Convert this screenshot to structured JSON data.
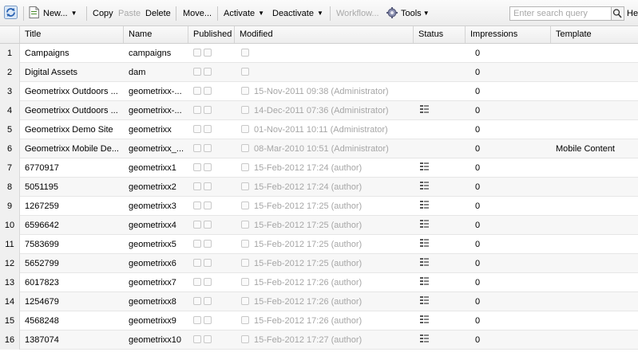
{
  "toolbar": {
    "new_label": "New...",
    "copy_label": "Copy",
    "paste_label": "Paste",
    "delete_label": "Delete",
    "move_label": "Move...",
    "activate_label": "Activate",
    "deactivate_label": "Deactivate",
    "workflow_label": "Workflow...",
    "tools_label": "Tools",
    "help_label": "He",
    "search_placeholder": "Enter search query"
  },
  "columns": {
    "title": "Title",
    "name": "Name",
    "published": "Published",
    "modified": "Modified",
    "status": "Status",
    "impressions": "Impressions",
    "template": "Template"
  },
  "rows": [
    {
      "num": "1",
      "title": "Campaigns",
      "name": "campaigns",
      "modified": "",
      "status_icon": false,
      "impressions": "0",
      "template": ""
    },
    {
      "num": "2",
      "title": "Digital Assets",
      "name": "dam",
      "modified": "",
      "status_icon": false,
      "impressions": "0",
      "template": ""
    },
    {
      "num": "3",
      "title": "Geometrixx Outdoors ...",
      "name": "geometrixx-...",
      "modified": "15-Nov-2011 09:38 (Administrator)",
      "status_icon": false,
      "impressions": "0",
      "template": ""
    },
    {
      "num": "4",
      "title": "Geometrixx Outdoors ...",
      "name": "geometrixx-...",
      "modified": "14-Dec-2011 07:36 (Administrator)",
      "status_icon": true,
      "impressions": "0",
      "template": ""
    },
    {
      "num": "5",
      "title": "Geometrixx Demo Site",
      "name": "geometrixx",
      "modified": "01-Nov-2011 10:11 (Administrator)",
      "status_icon": false,
      "impressions": "0",
      "template": ""
    },
    {
      "num": "6",
      "title": "Geometrixx Mobile De...",
      "name": "geometrixx_...",
      "modified": "08-Mar-2010 10:51 (Administrator)",
      "status_icon": false,
      "impressions": "0",
      "template": "Mobile Content"
    },
    {
      "num": "7",
      "title": "6770917",
      "name": "geometrixx1",
      "modified": "15-Feb-2012 17:24 (author)",
      "status_icon": true,
      "impressions": "0",
      "template": ""
    },
    {
      "num": "8",
      "title": "5051195",
      "name": "geometrixx2",
      "modified": "15-Feb-2012 17:24 (author)",
      "status_icon": true,
      "impressions": "0",
      "template": ""
    },
    {
      "num": "9",
      "title": "1267259",
      "name": "geometrixx3",
      "modified": "15-Feb-2012 17:25 (author)",
      "status_icon": true,
      "impressions": "0",
      "template": ""
    },
    {
      "num": "10",
      "title": "6596642",
      "name": "geometrixx4",
      "modified": "15-Feb-2012 17:25 (author)",
      "status_icon": true,
      "impressions": "0",
      "template": ""
    },
    {
      "num": "11",
      "title": "7583699",
      "name": "geometrixx5",
      "modified": "15-Feb-2012 17:25 (author)",
      "status_icon": true,
      "impressions": "0",
      "template": ""
    },
    {
      "num": "12",
      "title": "5652799",
      "name": "geometrixx6",
      "modified": "15-Feb-2012 17:25 (author)",
      "status_icon": true,
      "impressions": "0",
      "template": ""
    },
    {
      "num": "13",
      "title": "6017823",
      "name": "geometrixx7",
      "modified": "15-Feb-2012 17:26 (author)",
      "status_icon": true,
      "impressions": "0",
      "template": ""
    },
    {
      "num": "14",
      "title": "1254679",
      "name": "geometrixx8",
      "modified": "15-Feb-2012 17:26 (author)",
      "status_icon": true,
      "impressions": "0",
      "template": ""
    },
    {
      "num": "15",
      "title": "4568248",
      "name": "geometrixx9",
      "modified": "15-Feb-2012 17:26 (author)",
      "status_icon": true,
      "impressions": "0",
      "template": ""
    },
    {
      "num": "16",
      "title": "1387074",
      "name": "geometrixx10",
      "modified": "15-Feb-2012 17:27 (author)",
      "status_icon": true,
      "impressions": "0",
      "template": ""
    }
  ],
  "icons": {
    "refresh": "refresh-icon",
    "new_page": "new-page-icon",
    "tools": "tools-gear-icon",
    "search": "search-icon",
    "status": "status-list-icon",
    "checkbox": "checkbox-icon"
  }
}
